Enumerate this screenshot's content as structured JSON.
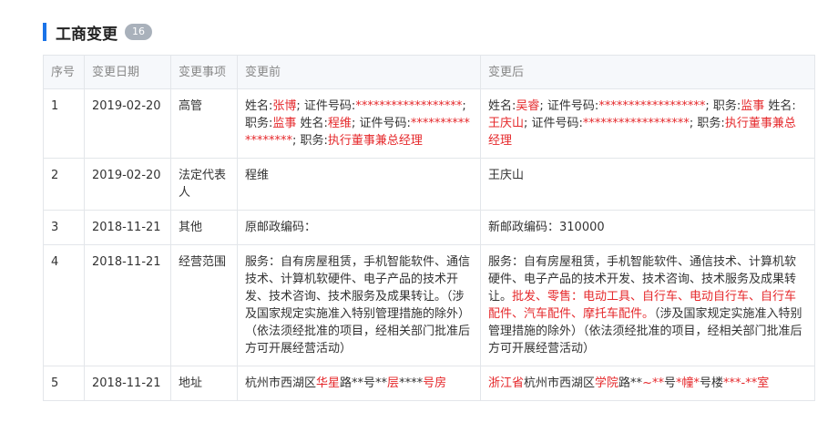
{
  "section": {
    "title": "工商变更",
    "count": "16"
  },
  "columns": [
    "序号",
    "变更日期",
    "变更事项",
    "变更前",
    "变更后"
  ],
  "rows": [
    {
      "index": "1",
      "date": "2019-02-20",
      "item": "高管",
      "before": [
        {
          "t": "姓名:"
        },
        {
          "t": "张博",
          "red": true
        },
        {
          "t": "; 证件号码:"
        },
        {
          "t": "******************",
          "red": true
        },
        {
          "t": "; 职务:"
        },
        {
          "t": "监事",
          "red": true
        },
        {
          "t": " 姓名:"
        },
        {
          "t": "程维",
          "red": true
        },
        {
          "t": "; 证件号码:"
        },
        {
          "t": "******************",
          "red": true
        },
        {
          "t": "; 职务:"
        },
        {
          "t": "执行董事兼总经理",
          "red": true
        }
      ],
      "after": [
        {
          "t": "姓名:"
        },
        {
          "t": "吴睿",
          "red": true
        },
        {
          "t": "; 证件号码:"
        },
        {
          "t": "******************",
          "red": true
        },
        {
          "t": "; 职务:"
        },
        {
          "t": "监事",
          "red": true
        },
        {
          "t": " 姓名:"
        },
        {
          "t": "王庆山",
          "red": true
        },
        {
          "t": "; 证件号码:"
        },
        {
          "t": "******************",
          "red": true
        },
        {
          "t": "; 职务:"
        },
        {
          "t": "执行董事兼总经理",
          "red": true
        }
      ]
    },
    {
      "index": "2",
      "date": "2019-02-20",
      "item": "法定代表人",
      "before": [
        {
          "t": "程维"
        }
      ],
      "after": [
        {
          "t": "王庆山"
        }
      ]
    },
    {
      "index": "3",
      "date": "2018-11-21",
      "item": "其他",
      "before": [
        {
          "t": "原邮政编码："
        }
      ],
      "after": [
        {
          "t": "新邮政编码：310000"
        }
      ]
    },
    {
      "index": "4",
      "date": "2018-11-21",
      "item": "经营范围",
      "before": [
        {
          "t": "服务：自有房屋租赁，手机智能软件、通信技术、计算机软硬件、电子产品的技术开发、技术咨询、技术服务及成果转让。（涉及国家规定实施准入特别管理措施的除外）（依法须经批准的项目，经相关部门批准后方可开展经营活动）"
        }
      ],
      "after": [
        {
          "t": "服务：自有房屋租赁，手机智能软件、通信技术、计算机软硬件、电子产品的技术开发、技术咨询、技术服务及成果转让。"
        },
        {
          "t": "批发、零售：电动工具、自行车、电动自行车、自行车配件、汽车配件、摩托车配件。",
          "red": true
        },
        {
          "t": "（涉及国家规定实施准入特别管理措施的除外）（依法须经批准的项目，经相关部门批准后方可开展经营活动）"
        }
      ]
    },
    {
      "index": "5",
      "date": "2018-11-21",
      "item": "地址",
      "before": [
        {
          "t": "杭州市西湖区"
        },
        {
          "t": "华星",
          "red": true
        },
        {
          "t": "路**号**"
        },
        {
          "t": "层",
          "red": true
        },
        {
          "t": "****"
        },
        {
          "t": "号房",
          "red": true
        }
      ],
      "after": [
        {
          "t": "浙江省",
          "red": true
        },
        {
          "t": "杭州市西湖区"
        },
        {
          "t": "学院",
          "red": true
        },
        {
          "t": "路**"
        },
        {
          "t": "~**",
          "red": true
        },
        {
          "t": "号"
        },
        {
          "t": "*幢*",
          "red": true
        },
        {
          "t": "号楼"
        },
        {
          "t": "***-**",
          "red": true
        },
        {
          "t": "室",
          "red": true
        }
      ]
    }
  ]
}
